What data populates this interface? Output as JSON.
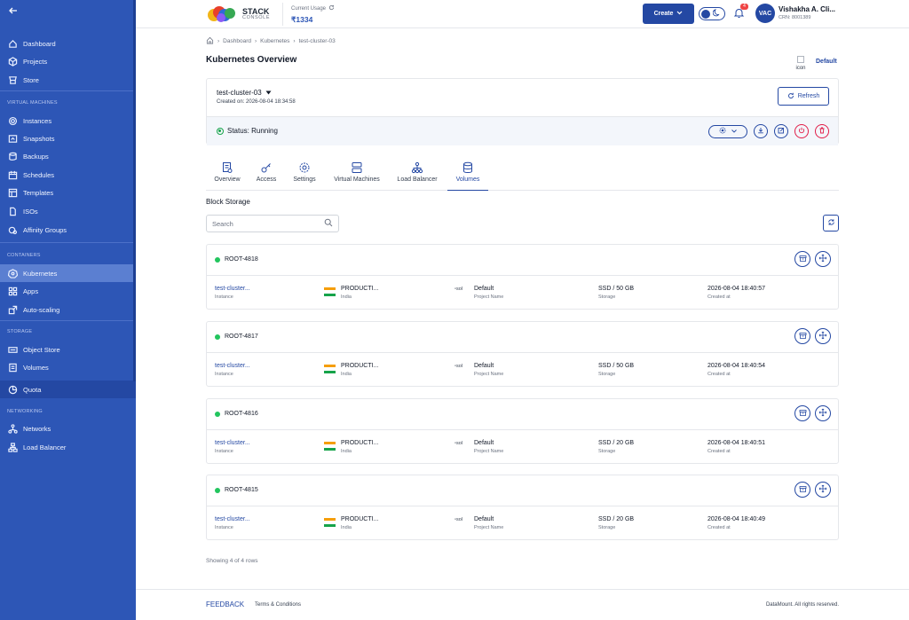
{
  "sidebar": {
    "sections": [
      "VIRTUAL MACHINES",
      "CONTAINERS",
      "STORAGE",
      "NETWORKING"
    ],
    "items": [
      {
        "label": "Dashboard",
        "icon": "home-icon"
      },
      {
        "label": "Projects",
        "icon": "cube-icon"
      },
      {
        "label": "Store",
        "icon": "store-icon"
      },
      {
        "label": "Instances",
        "icon": "gear-icon"
      },
      {
        "label": "Snapshots",
        "icon": "snapshot-icon"
      },
      {
        "label": "Backups",
        "icon": "database-icon"
      },
      {
        "label": "Schedules",
        "icon": "calendar-icon"
      },
      {
        "label": "Templates",
        "icon": "template-icon"
      },
      {
        "label": "ISOs",
        "icon": "disc-icon"
      },
      {
        "label": "Affinity Groups",
        "icon": "affinity-icon"
      },
      {
        "label": "Kubernetes",
        "icon": "kubernetes-icon"
      },
      {
        "label": "Apps",
        "icon": "apps-icon"
      },
      {
        "label": "Auto-scaling",
        "icon": "autoscale-icon"
      },
      {
        "label": "Object Store",
        "icon": "object-store-icon"
      },
      {
        "label": "Volumes",
        "icon": "volume-icon"
      },
      {
        "label": "Quota",
        "icon": "pie-icon"
      },
      {
        "label": "Networks",
        "icon": "network-icon"
      },
      {
        "label": "Load Balancer",
        "icon": "load-balancer-icon"
      }
    ],
    "active": "Kubernetes"
  },
  "header": {
    "logo_big": "STACK",
    "logo_small": "CONSOLE",
    "usage_label": "Current Usage",
    "usage_value": "₹1334",
    "create_label": "Create",
    "notification_count": "4",
    "avatar_initials": "VAC",
    "user_name": "Vishakha A. Cli...",
    "crn": "CRN: 8001389"
  },
  "breadcrumb": [
    "Dashboard",
    "Kubernetes",
    "test-cluster-03"
  ],
  "page_title": "Kubernetes Overview",
  "default_img_alt": "icon",
  "default_link": "Default",
  "cluster": {
    "name": "test-cluster-03",
    "created": "Created on: 2026-08-04 18:34:58",
    "refresh_label": "Refresh",
    "status": "Status: Running"
  },
  "tabs": [
    "Overview",
    "Access",
    "Settings",
    "Virtual Machines",
    "Load Balancer",
    "Volumes"
  ],
  "active_tab": "Volumes",
  "section_title": "Block Storage",
  "search_placeholder": "Search",
  "volumes": [
    {
      "name": "ROOT-4818",
      "instance": "test-cluster...",
      "instance_label": "Instance",
      "zone": "PRODUCTI...",
      "region": "India",
      "img": "sol",
      "project": "Default",
      "project_label": "Project Name",
      "storage": "SSD / 50 GB",
      "storage_label": "Storage",
      "created": "2026-08-04 18:40:57",
      "created_label": "Created at"
    },
    {
      "name": "ROOT-4817",
      "instance": "test-cluster...",
      "instance_label": "Instance",
      "zone": "PRODUCTI...",
      "region": "India",
      "img": "sol",
      "project": "Default",
      "project_label": "Project Name",
      "storage": "SSD / 50 GB",
      "storage_label": "Storage",
      "created": "2026-08-04 18:40:54",
      "created_label": "Created at"
    },
    {
      "name": "ROOT-4816",
      "instance": "test-cluster...",
      "instance_label": "Instance",
      "zone": "PRODUCTI...",
      "region": "India",
      "img": "sol",
      "project": "Default",
      "project_label": "Project Name",
      "storage": "SSD / 20 GB",
      "storage_label": "Storage",
      "created": "2026-08-04 18:40:51",
      "created_label": "Created at"
    },
    {
      "name": "ROOT-4815",
      "instance": "test-cluster...",
      "instance_label": "Instance",
      "zone": "PRODUCTI...",
      "region": "India",
      "img": "sol",
      "project": "Default",
      "project_label": "Project Name",
      "storage": "SSD / 20 GB",
      "storage_label": "Storage",
      "created": "2026-08-04 18:40:49",
      "created_label": "Created at"
    }
  ],
  "showing": "Showing 4 of 4 rows",
  "footer": {
    "feedback": "FEEDBACK",
    "terms": "Terms & Conditions",
    "rights": "DataMount. All rights reserved."
  },
  "colors": {
    "sidebar": "#2d56b6",
    "accent": "#2448a3",
    "active_item": "#5b7fd1",
    "status_green": "#22c55e",
    "danger": "#e11d48"
  }
}
